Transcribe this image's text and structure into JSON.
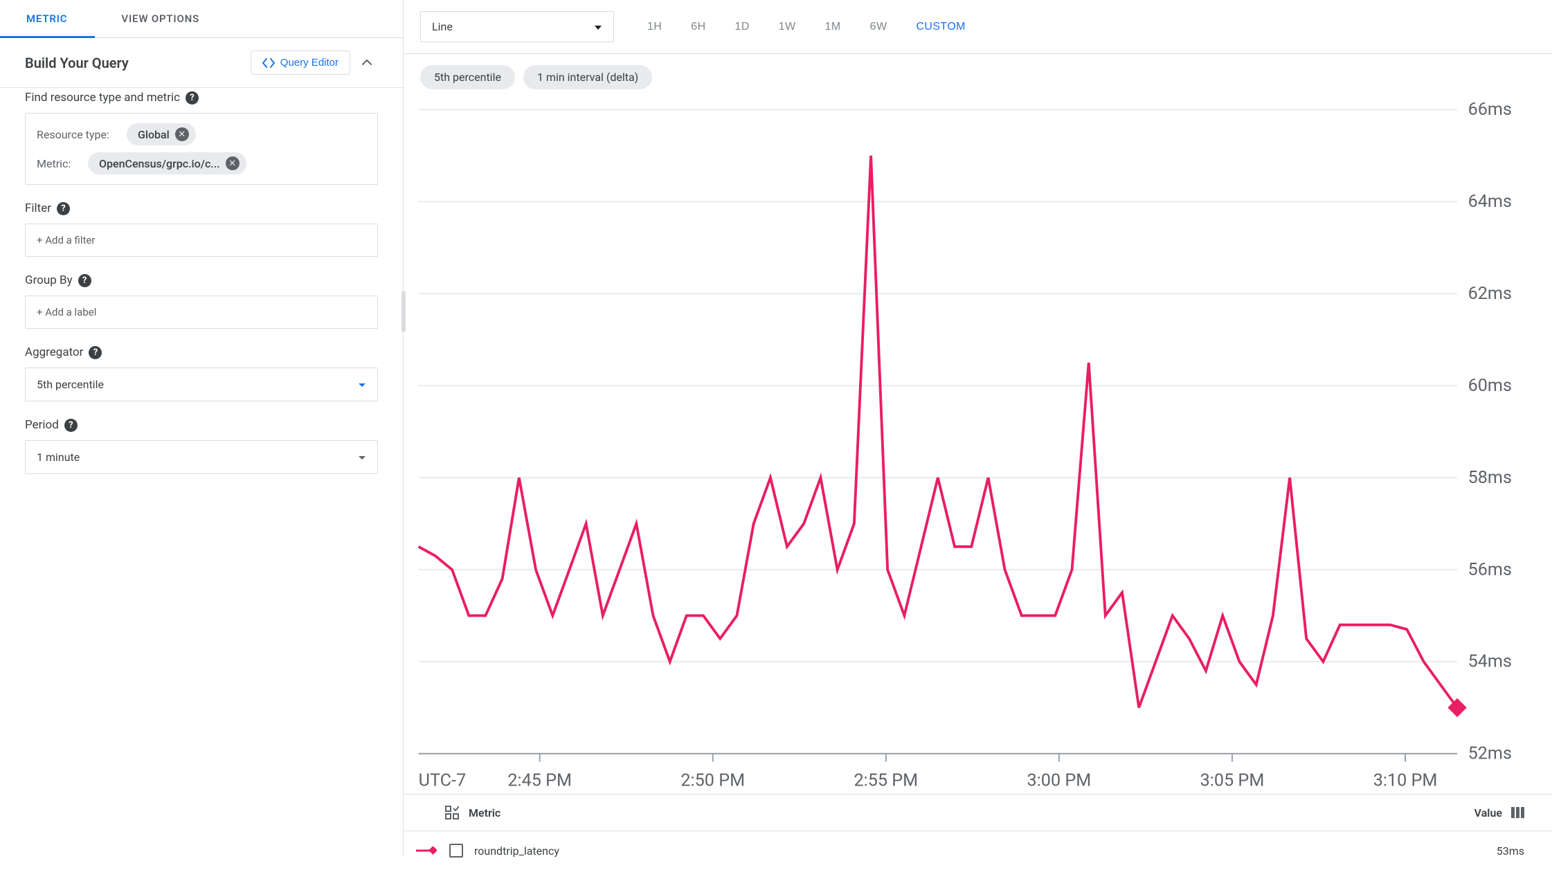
{
  "tabs": {
    "metric": "METRIC",
    "view_options": "VIEW OPTIONS"
  },
  "build_query": {
    "title": "Build Your Query",
    "query_editor": "Query Editor"
  },
  "find_metric": {
    "label": "Find resource type and metric",
    "resource_type_label": "Resource type:",
    "resource_type_value": "Global",
    "metric_label": "Metric:",
    "metric_value": "OpenCensus/grpc.io/c..."
  },
  "filter": {
    "label": "Filter",
    "placeholder": "+ Add a filter"
  },
  "group_by": {
    "label": "Group By",
    "placeholder": "+ Add a label"
  },
  "aggregator": {
    "label": "Aggregator",
    "value": "5th percentile"
  },
  "period": {
    "label": "Period",
    "value": "1 minute"
  },
  "chart_type": {
    "value": "Line"
  },
  "time_ranges": [
    "1H",
    "6H",
    "1D",
    "1W",
    "1M",
    "6W"
  ],
  "time_range_custom": "CUSTOM",
  "info_chips": {
    "percentile": "5th percentile",
    "interval": "1 min interval (delta)"
  },
  "legend": {
    "metric_header": "Metric",
    "value_header": "Value",
    "series_name": "roundtrip_latency",
    "series_value": "53ms"
  },
  "chart_data": {
    "type": "line",
    "title": "",
    "xlabel": "UTC-7",
    "ylabel": "",
    "tz_label": "UTC-7",
    "ylim": [
      52,
      66
    ],
    "y_ticks": [
      "52ms",
      "54ms",
      "56ms",
      "58ms",
      "60ms",
      "62ms",
      "64ms",
      "66ms"
    ],
    "x_ticks": [
      "2:45 PM",
      "2:50 PM",
      "2:55 PM",
      "3:00 PM",
      "3:05 PM",
      "3:10 PM"
    ],
    "series": [
      {
        "name": "roundtrip_latency",
        "color": "#e91e63",
        "values": [
          56.5,
          56.3,
          56,
          55,
          55,
          55.8,
          58,
          56,
          55,
          56,
          57,
          55,
          56,
          57,
          55,
          54,
          55,
          55,
          54.5,
          55,
          57,
          58,
          56.5,
          57,
          58,
          56,
          57,
          65,
          56,
          55,
          56.5,
          58,
          56.5,
          56.5,
          58,
          56,
          55,
          55,
          55,
          56,
          60.5,
          55,
          55.5,
          53,
          54,
          55,
          54.5,
          53.8,
          55,
          54,
          53.5,
          55,
          58,
          54.5,
          54,
          54.8,
          54.8,
          54.8,
          54.8,
          54.7,
          54,
          53.5,
          53
        ]
      }
    ],
    "end_marker": {
      "shape": "diamond",
      "color": "#e91e63"
    }
  }
}
